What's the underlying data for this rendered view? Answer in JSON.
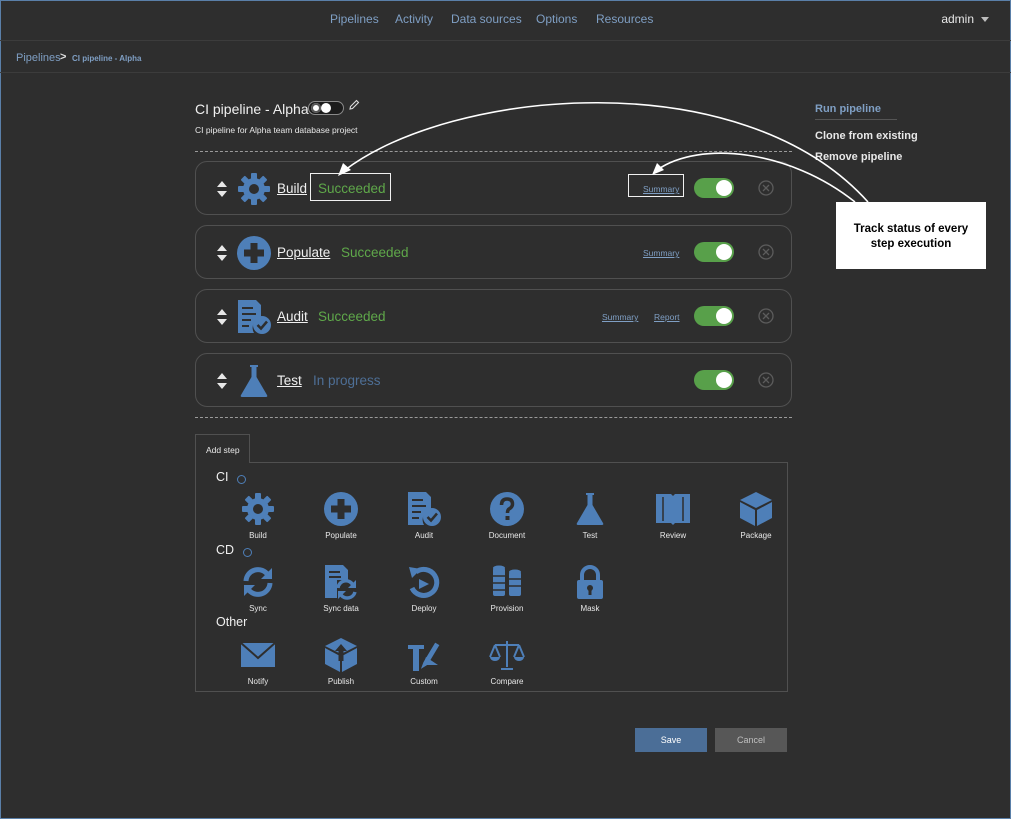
{
  "nav": {
    "links": [
      "Pipelines",
      "Activity",
      "Data sources",
      "Options",
      "Resources"
    ],
    "user": "admin"
  },
  "breadcrumb": {
    "root": "Pipelines",
    "separator": ">",
    "current": "CI pipeline - Alpha"
  },
  "pipeline": {
    "title": "CI pipeline - Alpha",
    "description": "CI pipeline for Alpha team database project"
  },
  "steps": [
    {
      "name": "Build",
      "status": "Succeeded",
      "links": [
        "Summary"
      ],
      "icon": "gear-icon",
      "enabled": true
    },
    {
      "name": "Populate",
      "status": "Succeeded",
      "links": [
        "Summary"
      ],
      "icon": "plus-circle-icon",
      "enabled": true
    },
    {
      "name": "Audit",
      "status": "Succeeded",
      "links": [
        "Summary",
        "Report"
      ],
      "icon": "audit-icon",
      "enabled": true
    },
    {
      "name": "Test",
      "status": "In progress",
      "links": [],
      "icon": "flask-icon",
      "enabled": true
    }
  ],
  "actions": {
    "run": "Run pipeline",
    "clone": "Clone from existing",
    "remove": "Remove pipeline"
  },
  "callout": {
    "line1": "Track status of every",
    "line2": "step execution"
  },
  "add_step": {
    "tab_label": "Add step",
    "categories": [
      {
        "name": "CI",
        "items": [
          "Build",
          "Populate",
          "Audit",
          "Document",
          "Test",
          "Review",
          "Package"
        ]
      },
      {
        "name": "CD",
        "items": [
          "Sync",
          "Sync data",
          "Deploy",
          "Provision",
          "Mask"
        ]
      },
      {
        "name": "Other",
        "items": [
          "Notify",
          "Publish",
          "Custom",
          "Compare"
        ]
      }
    ]
  },
  "buttons": {
    "save": "Save",
    "cancel": "Cancel"
  },
  "colors": {
    "accent": "#4e7fb8",
    "link": "#7f9fc4",
    "success": "#5fa84a",
    "toggle_on": "#58a04a",
    "background": "#2e2e2e"
  }
}
